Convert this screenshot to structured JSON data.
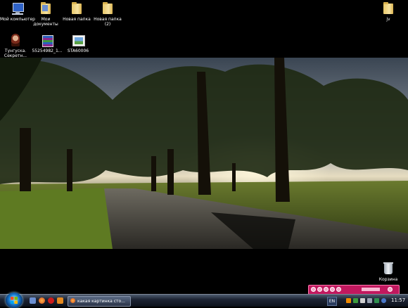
{
  "desktop": {
    "icons": [
      {
        "label": "Мой компьютер",
        "icon": "computer-icon"
      },
      {
        "label": "Мои документы",
        "icon": "folder-icon"
      },
      {
        "label": "Новая папка",
        "icon": "folder-icon"
      },
      {
        "label": "Новая папка (2)",
        "icon": "folder-icon"
      },
      {
        "label": "jv",
        "icon": "folder-icon"
      },
      {
        "label": "Тунгуска. Секретн...",
        "icon": "game-icon"
      },
      {
        "label": "55254982_1...",
        "icon": "archive-icon"
      },
      {
        "label": "STA60006",
        "icon": "image-file-icon"
      },
      {
        "label": "Корзина",
        "icon": "recycle-bin-icon"
      }
    ]
  },
  "taskbar": {
    "window_button_label": "какая картинка сто...",
    "language": "EN",
    "clock": "11:57"
  },
  "colors": {
    "taskbar": "#1d2433",
    "media_player": "#c1185e",
    "desktop": "#000000"
  }
}
